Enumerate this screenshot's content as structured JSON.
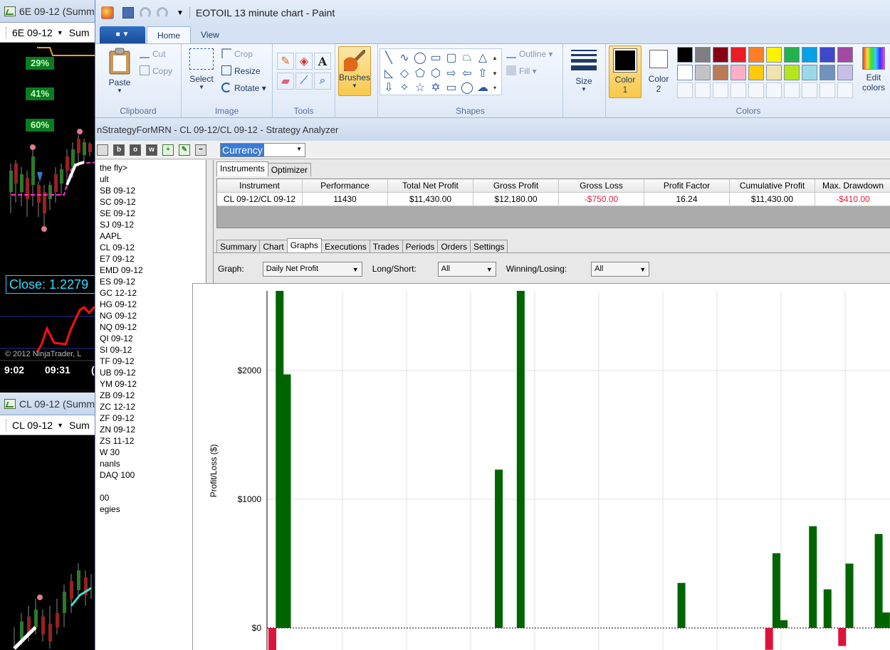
{
  "ninja_top": {
    "title": "6E 09-12 (Summ",
    "symbol": "6E 09-12",
    "period": "Sum",
    "badges": [
      "29%",
      "41%",
      "60%"
    ],
    "close_label": "Close: 1.2279",
    "copyright": "© 2012 NinjaTrader, L",
    "time_labels": [
      "9:02",
      "09:31",
      "("
    ]
  },
  "ninja_bottom": {
    "title": "CL 09-12 (Summ",
    "symbol": "CL 09-12",
    "period": "Sum"
  },
  "paint": {
    "window_title": "EOTOIL 13 minute chart - Paint",
    "tabs": [
      "Home",
      "View"
    ],
    "clipboard": {
      "paste": "Paste",
      "cut": "Cut",
      "copy": "Copy",
      "label": "Clipboard"
    },
    "image": {
      "select": "Select",
      "crop": "Crop",
      "resize": "Resize",
      "rotate": "Rotate",
      "label": "Image"
    },
    "tools": {
      "label": "Tools",
      "text_glyph": "A"
    },
    "brushes": "Brushes",
    "shapes": {
      "outline": "Outline",
      "fill": "Fill",
      "label": "Shapes"
    },
    "size": "Size",
    "color1": {
      "line1": "Color",
      "line2": "1"
    },
    "color2": {
      "line1": "Color",
      "line2": "2"
    },
    "colors_label": "Colors",
    "edit_colors": {
      "line1": "Edit",
      "line2": "colors"
    },
    "palette_row1": [
      "#000000",
      "#7f7f7f",
      "#880015",
      "#ed1c24",
      "#ff7f27",
      "#fff200",
      "#22b14c",
      "#00a2e8",
      "#3f48cc",
      "#a349a4"
    ],
    "palette_row2": [
      "#ffffff",
      "#c3c3c3",
      "#b97a57",
      "#ffaec9",
      "#ffc90e",
      "#efe4b0",
      "#b5e61d",
      "#99d9ea",
      "#7092be",
      "#c8bfe7"
    ]
  },
  "analyzer": {
    "title": "nStrategyForMRN - CL 09-12/CL 09-12 - Strategy Analyzer",
    "currency": "Currency",
    "toolbar_letters": [
      "b",
      "o",
      "w"
    ],
    "left_list": [
      "the fly>",
      "ult",
      "SB 09-12",
      "SC 09-12",
      "SE 09-12",
      "SJ 09-12",
      "AAPL",
      "CL 09-12",
      "E7 09-12",
      "EMD 09-12",
      "ES 09-12",
      "GC 12-12",
      "HG 09-12",
      "NG 09-12",
      "NQ 09-12",
      "QI 09-12",
      "SI 09-12",
      "TF 09-12",
      "UB 09-12",
      "YM 09-12",
      "ZB 09-12",
      "ZC 12-12",
      "ZF 09-12",
      "ZN 09-12",
      "ZS 11-12",
      "W 30",
      "nanls",
      "DAQ 100",
      "",
      "00",
      "egies"
    ],
    "top_tabs": [
      "Instruments",
      "Optimizer"
    ],
    "columns": [
      "Instrument",
      "Performance",
      "Total Net Profit",
      "Gross Profit",
      "Gross Loss",
      "Profit Factor",
      "Cumulative Profit",
      "Max. Drawdown"
    ],
    "row": [
      "CL 09-12/CL 09-12",
      "11430",
      "$11,430.00",
      "$12,180.00",
      "-$750.00",
      "16.24",
      "$11,430.00",
      "-$410.00"
    ],
    "sub_tabs": [
      "Summary",
      "Chart",
      "Graphs",
      "Executions",
      "Trades",
      "Periods",
      "Orders",
      "Settings"
    ],
    "active_sub_tab": "Graphs",
    "filters": {
      "graph_label": "Graph:",
      "graph_value": "Daily Net Profit",
      "ls_label": "Long/Short:",
      "ls_value": "All",
      "wl_label": "Winning/Losing:",
      "wl_value": "All"
    }
  },
  "chart_data": {
    "type": "bar",
    "title": "",
    "ylabel": "Profit/Loss ($)",
    "ylim": [
      -170,
      2620
    ],
    "yticks": [
      "$0",
      "$1000",
      "$2000"
    ],
    "positive_color": "#006400",
    "negative_color": "#dc143c",
    "bars": [
      {
        "x": 0,
        "value": -180
      },
      {
        "x": 1,
        "value": 2620
      },
      {
        "x": 2,
        "value": 1970
      },
      {
        "x": 31,
        "value": 1230
      },
      {
        "x": 34,
        "value": 2620
      },
      {
        "x": 56,
        "value": 350
      },
      {
        "x": 68,
        "value": -170
      },
      {
        "x": 69,
        "value": 580
      },
      {
        "x": 70,
        "value": 60
      },
      {
        "x": 74,
        "value": 790
      },
      {
        "x": 76,
        "value": 300
      },
      {
        "x": 78,
        "value": -140
      },
      {
        "x": 79,
        "value": 500
      },
      {
        "x": 83,
        "value": 730
      },
      {
        "x": 84,
        "value": 120
      }
    ]
  }
}
